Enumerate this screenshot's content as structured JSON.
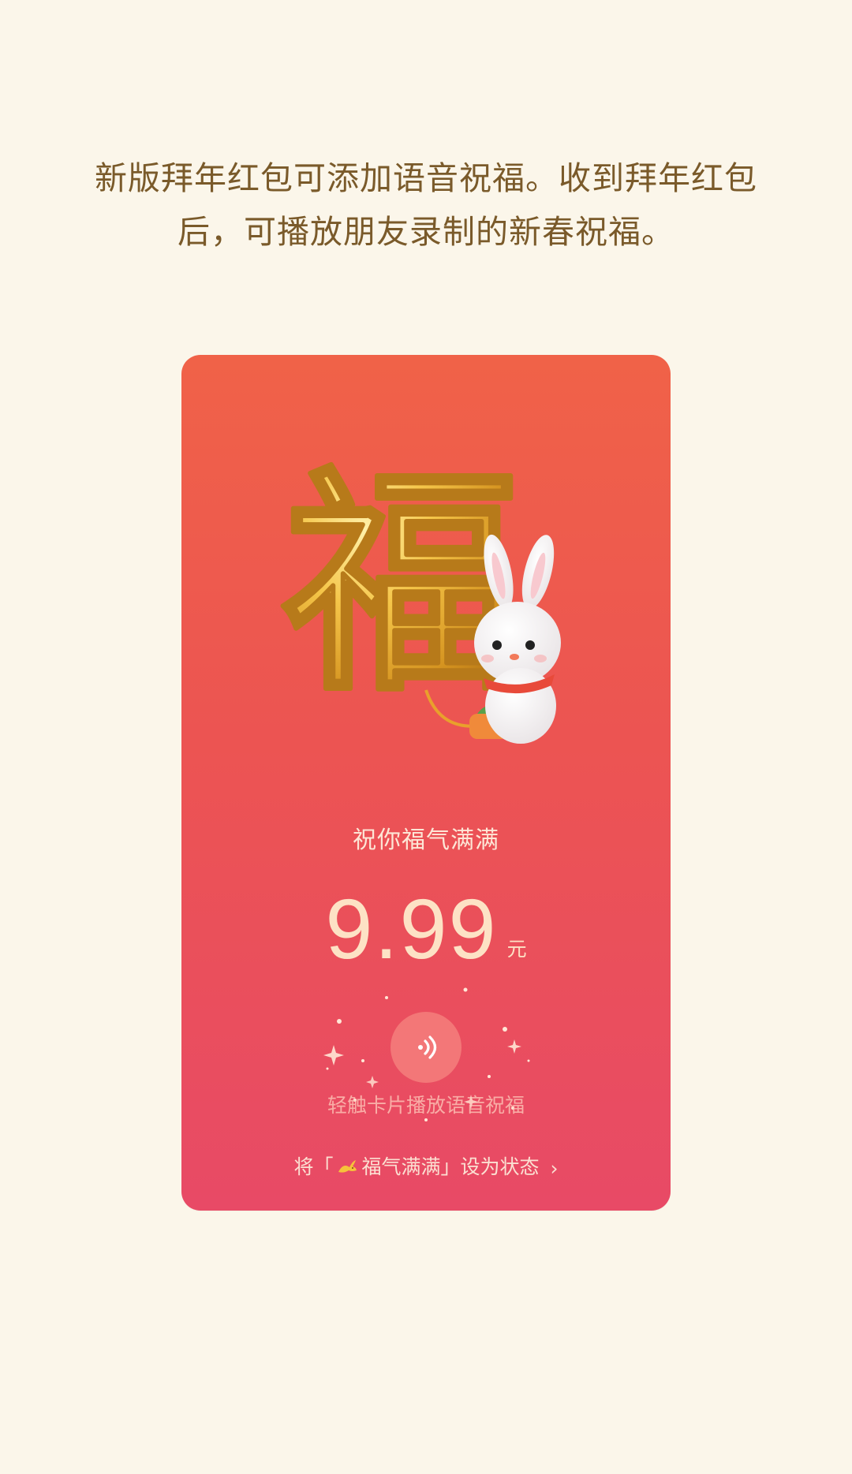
{
  "intro": {
    "line1": "新版拜年红包可添加语音祝福。收到拜年红包",
    "line2": "后，可播放朋友录制的新春祝福。"
  },
  "card": {
    "art_character": "福",
    "greeting": "祝你福气满满",
    "amount": "9.99",
    "unit": "元",
    "voice_icon": "voice-wave-icon",
    "tap_hint": "轻触卡片播放语音祝福",
    "status": {
      "prefix": "将「",
      "label": "福气满满",
      "suffix": "」设为状态",
      "chevron": "›"
    }
  },
  "colors": {
    "page_bg": "#fbf6ea",
    "intro_text": "#7a5a2a",
    "card_top": "#f06248",
    "card_bottom": "#e84a66",
    "gold": "#e8b33c",
    "amount": "#fde2c5"
  }
}
